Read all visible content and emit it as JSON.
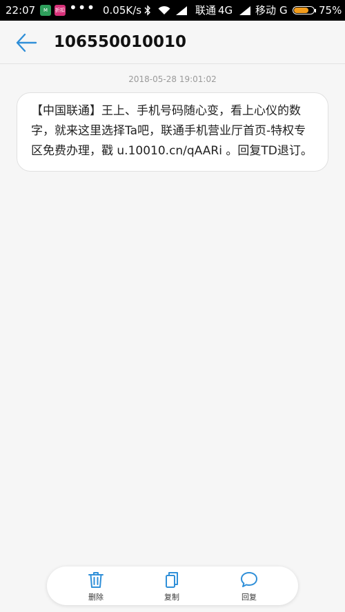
{
  "status_bar": {
    "time": "22:07",
    "app1": "M",
    "app2": "折扣",
    "dots": "•••",
    "speed": "0.05K/s",
    "carrier1": "联通",
    "network1": "4G",
    "carrier2": "移动",
    "network2": "G",
    "battery": "75%",
    "battery_level": 0.75,
    "battery_color": "#f39c1a"
  },
  "header": {
    "title": "106550010010",
    "accent_color": "#2f8fd8"
  },
  "conversation": {
    "timestamp": "2018-05-28 19:01:02",
    "message": "【中国联通】王上、手机号码随心变，看上心仪的数字，就来这里选择Ta吧，联通手机营业厅首页-特权专区免费办理，戳 u.10010.cn/qAARi 。回复TD退订。"
  },
  "toolbar": {
    "delete_label": "删除",
    "copy_label": "复制",
    "reply_label": "回复",
    "icon_color": "#2f8fd8"
  }
}
